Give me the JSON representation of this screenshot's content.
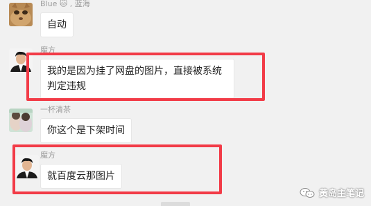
{
  "chat": {
    "messages": [
      {
        "sender": "Blue 🐱 , 蓝海",
        "text": "自动"
      },
      {
        "sender": "魔方",
        "text": "我的是因为挂了网盘的图片，直接被系统判定违规"
      },
      {
        "sender": "一杯清茶",
        "text": "你这个是下架时间"
      },
      {
        "sender": "魔方",
        "text": "就百度云那图片"
      }
    ]
  },
  "watermark": {
    "text": "黄岛主笔记",
    "icon": "wechat-official-account-icon"
  },
  "colors": {
    "background": "#f1f1f1",
    "bubble": "#ffffff",
    "highlight": "#f23b47",
    "username": "#9b9b9b"
  }
}
